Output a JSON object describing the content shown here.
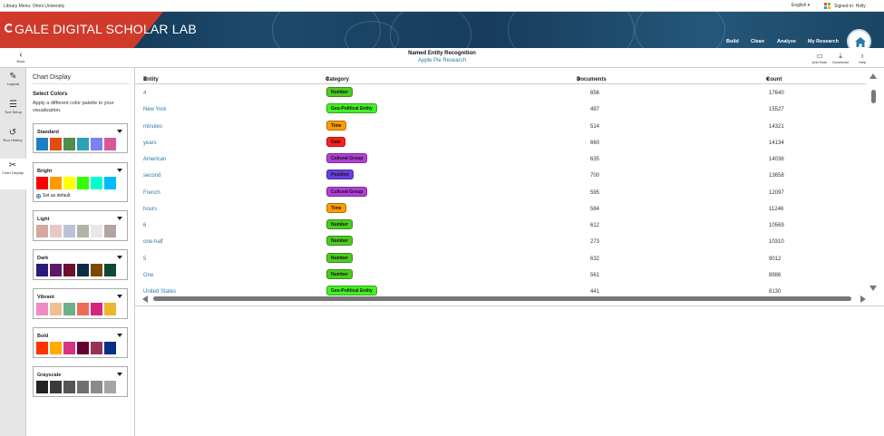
{
  "topbar": {
    "library_menu": "Library Menu: Omni University",
    "language": "English",
    "signed_in": "Signed in: Holly"
  },
  "banner": {
    "app_name": "GALE DIGITAL SCHOLAR LAB",
    "nav": [
      "Build",
      "Clean",
      "Analyze",
      "My Research"
    ]
  },
  "header": {
    "back_label": "Back",
    "title": "Named Entity Recognition",
    "subtitle": "Apple Pie Research",
    "tools": [
      "Add Note",
      "Download",
      "Help"
    ]
  },
  "rail": {
    "items": [
      {
        "label": "Legend",
        "icon": "legend-icon"
      },
      {
        "label": "Tool Setup",
        "icon": "sliders-icon"
      },
      {
        "label": "Run History",
        "icon": "history-icon"
      },
      {
        "label": "Chart Display",
        "icon": "scissors-icon"
      }
    ]
  },
  "panel": {
    "title": "Chart Display",
    "heading": "Select Colors",
    "description": "Apply a different color palette to your visualization.",
    "set_default": "Set as default",
    "palettes": [
      {
        "name": "Standard",
        "colors": [
          "#1f7fc4",
          "#e04d12",
          "#4f8d51",
          "#2aa2b9",
          "#7b83f2",
          "#d6589a"
        ]
      },
      {
        "name": "Bright",
        "colors": [
          "#ff0000",
          "#ff9900",
          "#ffff00",
          "#33ff00",
          "#00ffcc",
          "#00bbff"
        ]
      },
      {
        "name": "Light",
        "colors": [
          "#d4a8a0",
          "#e6c9c3",
          "#b9c3d6",
          "#b3b3a3",
          "#e8e8e8",
          "#b4a3a3"
        ]
      },
      {
        "name": "Dark",
        "colors": [
          "#2b1a7a",
          "#5c1a6b",
          "#6e0f2e",
          "#0e2b47",
          "#7a4a00",
          "#0e4a33"
        ]
      },
      {
        "name": "Vibrant",
        "colors": [
          "#f08bc5",
          "#f0c08e",
          "#6bb08a",
          "#ee6a55",
          "#d4247f",
          "#ebb52e"
        ]
      },
      {
        "name": "Bold",
        "colors": [
          "#ff3300",
          "#ffaa00",
          "#d63384",
          "#660033",
          "#993355",
          "#0a2f8a"
        ]
      },
      {
        "name": "Grayscale",
        "colors": [
          "#222222",
          "#3a3a3a",
          "#555555",
          "#707070",
          "#8a8a8a",
          "#a5a5a5"
        ]
      }
    ]
  },
  "table": {
    "columns": [
      "Entity",
      "Category",
      "Documents",
      "Count"
    ],
    "rows": [
      {
        "entity": "4",
        "category": "Number",
        "color": "#4ccc1f",
        "documents": "656",
        "count": "17640"
      },
      {
        "entity": "New York",
        "category": "Geo-Political Entity",
        "color": "#44f022",
        "documents": "497",
        "count": "15527"
      },
      {
        "entity": "minutes",
        "category": "Time",
        "color": "#ff9d00",
        "documents": "514",
        "count": "14321"
      },
      {
        "entity": "years",
        "category": "Date",
        "color": "#ff1e1e",
        "documents": "660",
        "count": "14134"
      },
      {
        "entity": "American",
        "category": "Cultural Group",
        "color": "#b23fd6",
        "documents": "635",
        "count": "14036"
      },
      {
        "entity": "second",
        "category": "Position",
        "color": "#6a3fe0",
        "documents": "700",
        "count": "13658"
      },
      {
        "entity": "French",
        "category": "Cultural Group",
        "color": "#b23fd6",
        "documents": "595",
        "count": "12097"
      },
      {
        "entity": "hours",
        "category": "Time",
        "color": "#ff9d00",
        "documents": "584",
        "count": "11246"
      },
      {
        "entity": "6",
        "category": "Number",
        "color": "#4ccc1f",
        "documents": "612",
        "count": "10569"
      },
      {
        "entity": "one-half",
        "category": "Number",
        "color": "#4ccc1f",
        "documents": "273",
        "count": "10310"
      },
      {
        "entity": "5",
        "category": "Number",
        "color": "#4ccc1f",
        "documents": "632",
        "count": "9012"
      },
      {
        "entity": "One",
        "category": "Number",
        "color": "#4ccc1f",
        "documents": "561",
        "count": "8986"
      },
      {
        "entity": "United States",
        "category": "Geo-Political Entity",
        "color": "#44f022",
        "documents": "441",
        "count": "8130"
      }
    ]
  }
}
